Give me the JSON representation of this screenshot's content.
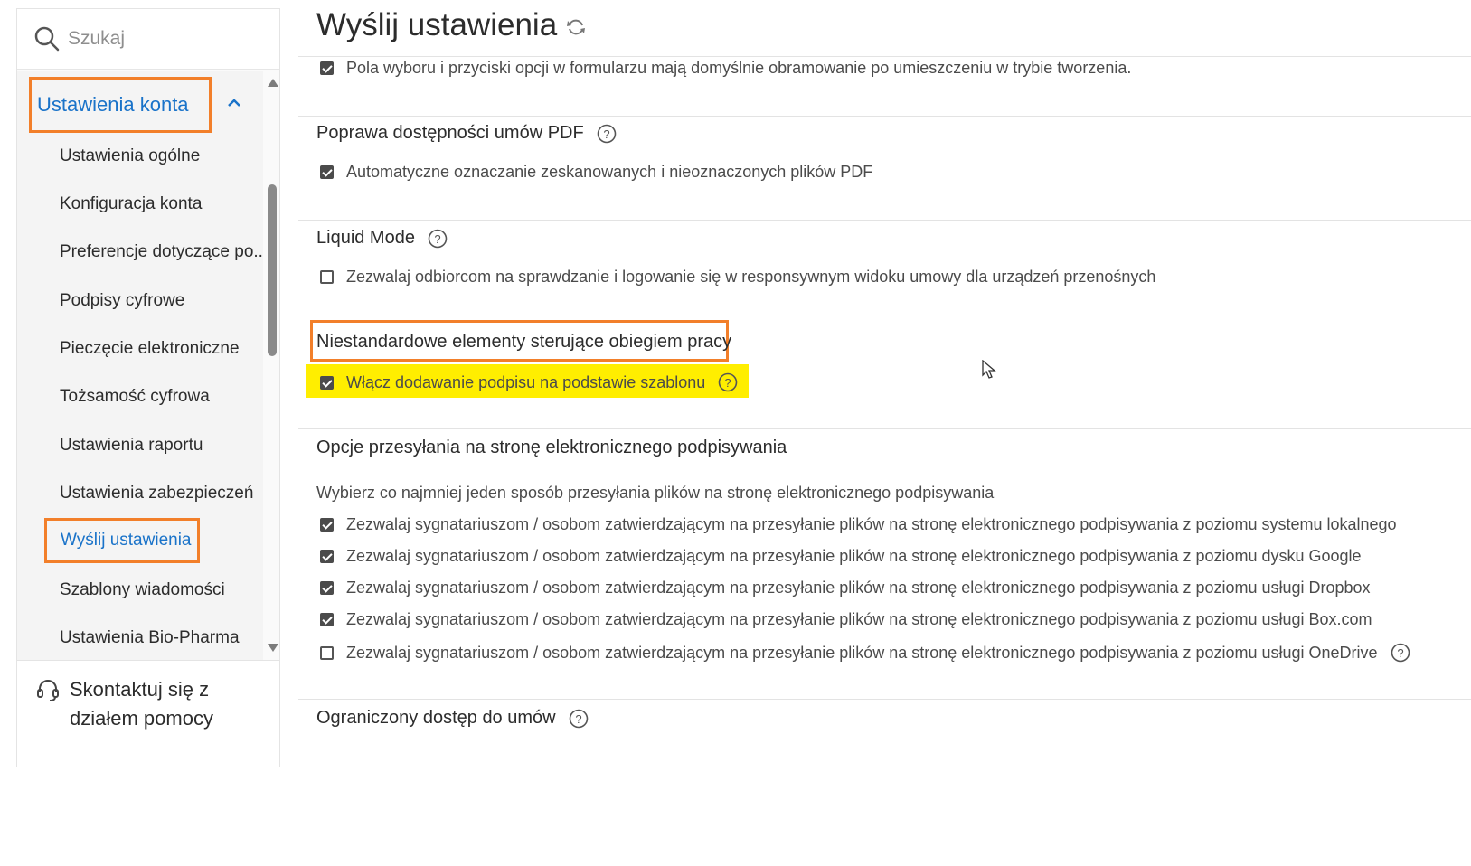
{
  "sidebar": {
    "search_placeholder": "Szukaj",
    "section_label": "Ustawienia konta",
    "items": [
      {
        "label": "Ustawienia ogólne"
      },
      {
        "label": "Konfiguracja konta"
      },
      {
        "label": "Preferencje dotyczące po..."
      },
      {
        "label": "Podpisy cyfrowe"
      },
      {
        "label": "Pieczęcie elektroniczne"
      },
      {
        "label": "Tożsamość cyfrowa"
      },
      {
        "label": "Ustawienia raportu"
      },
      {
        "label": "Ustawienia zabezpieczeń"
      },
      {
        "label": "Wyślij ustawienia"
      },
      {
        "label": "Szablony wiadomości"
      },
      {
        "label": "Ustawienia Bio-Pharma"
      }
    ],
    "active_item": "Wyślij ustawienia",
    "help_label": "Skontaktuj się z działem pomocy"
  },
  "main": {
    "title": "Wyślij ustawienia",
    "form_fields_row": {
      "label": "Pola wyboru i przyciski opcji w formularzu mają domyślnie obramowanie po umieszczeniu w trybie tworzenia.",
      "checked": true
    },
    "pdf_access": {
      "title": "Poprawa dostępności umów PDF",
      "option": {
        "label": "Automatyczne oznaczanie zeskanowanych i nieoznaczonych plików PDF",
        "checked": true
      }
    },
    "liquid_mode": {
      "title": "Liquid Mode",
      "option": {
        "label": "Zezwalaj odbiorcom na sprawdzanie i logowanie się w responsywnym widoku umowy dla urządzeń przenośnych",
        "checked": false
      }
    },
    "workflow": {
      "title": "Niestandardowe elementy sterujące obiegiem pracy",
      "option": {
        "label": "Włącz dodawanie podpisu na podstawie szablonu",
        "checked": true
      }
    },
    "upload": {
      "title": "Opcje przesyłania na stronę elektronicznego podpisywania",
      "description": "Wybierz co najmniej jeden sposób przesyłania plików na stronę elektronicznego podpisywania",
      "options": [
        {
          "label": "Zezwalaj sygnatariuszom / osobom zatwierdzającym na przesyłanie plików na stronę elektronicznego podpisywania z poziomu systemu lokalnego",
          "checked": true
        },
        {
          "label": "Zezwalaj sygnatariuszom / osobom zatwierdzającym na przesyłanie plików na stronę elektronicznego podpisywania z poziomu dysku Google",
          "checked": true
        },
        {
          "label": "Zezwalaj sygnatariuszom / osobom zatwierdzającym na przesyłanie plików na stronę elektronicznego podpisywania z poziomu usługi Dropbox",
          "checked": true
        },
        {
          "label": "Zezwalaj sygnatariuszom / osobom zatwierdzającym na przesyłanie plików na stronę elektronicznego podpisywania z poziomu usługi Box.com",
          "checked": true
        },
        {
          "label": "Zezwalaj sygnatariuszom / osobom zatwierdzającym na przesyłanie plików na stronę elektronicznego podpisywania z poziomu usługi OneDrive",
          "checked": false
        }
      ]
    },
    "restricted": {
      "title": "Ograniczony dostęp do umów"
    }
  },
  "colors": {
    "accent": "#1a73c9",
    "callout": "#f27f2a",
    "highlight": "#ffee00"
  }
}
